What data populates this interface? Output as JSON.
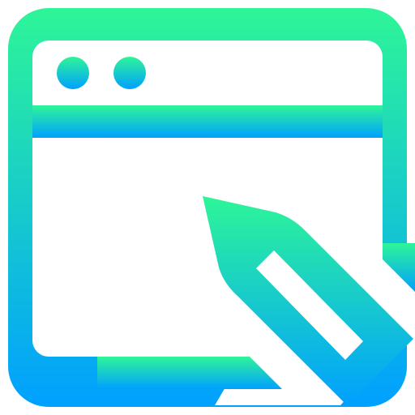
{
  "icon": {
    "name": "browser-window-edit-icon",
    "gradient": {
      "top_color": "#2ef598",
      "bottom_color": "#00a0ff"
    },
    "background": "#ffffff"
  }
}
